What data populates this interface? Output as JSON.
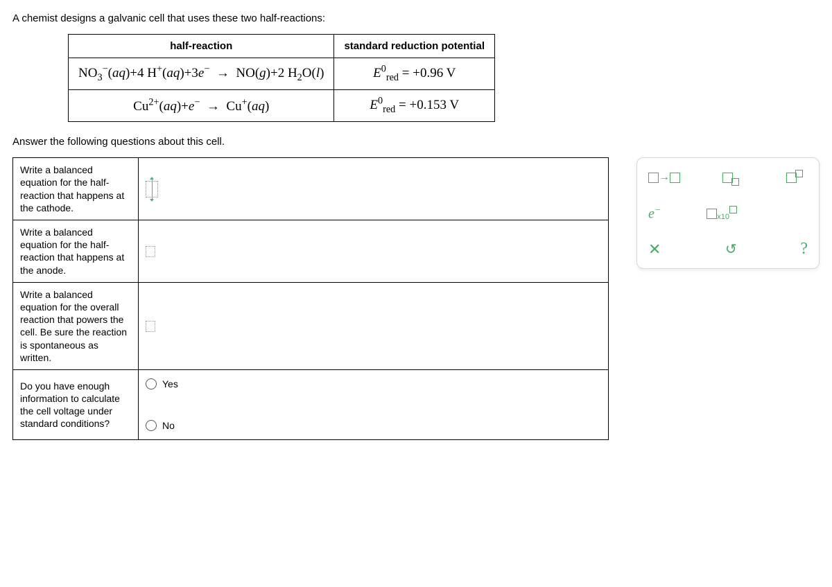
{
  "intro": "A chemist designs a galvanic cell that uses these two half-reactions:",
  "refTable": {
    "headers": {
      "col1": "half-reaction",
      "col2": "standard reduction potential"
    },
    "rows": [
      {
        "reaction": "NO₃⁻(aq) + 4 H⁺(aq) + 3e⁻  →  NO(g) + 2 H₂O(l)",
        "potential": "= +0.96 V"
      },
      {
        "reaction": "Cu²⁺(aq) + e⁻  →  Cu⁺(aq)",
        "potential": "= +0.153 V"
      }
    ]
  },
  "prompt2": "Answer the following questions about this cell.",
  "questions": {
    "q1": "Write a balanced equation for the half-reaction that happens at the cathode.",
    "q2": "Write a balanced equation for the half-reaction that happens at the anode.",
    "q3": "Write a balanced equation for the overall reaction that powers the cell. Be sure the reaction is spontaneous as written.",
    "q4": "Do you have enough information to calculate the cell voltage under standard conditions?"
  },
  "radio": {
    "yes": "Yes",
    "no": "No"
  },
  "palette": {
    "x10": "x10"
  },
  "chart_data": {
    "type": "table",
    "title": "Standard reduction potentials",
    "columns": [
      "half-reaction",
      "E0_red (V)"
    ],
    "rows": [
      [
        "NO3-(aq) + 4 H+(aq) + 3 e-  ->  NO(g) + 2 H2O(l)",
        0.96
      ],
      [
        "Cu2+(aq) + e-  ->  Cu+(aq)",
        0.153
      ]
    ]
  }
}
